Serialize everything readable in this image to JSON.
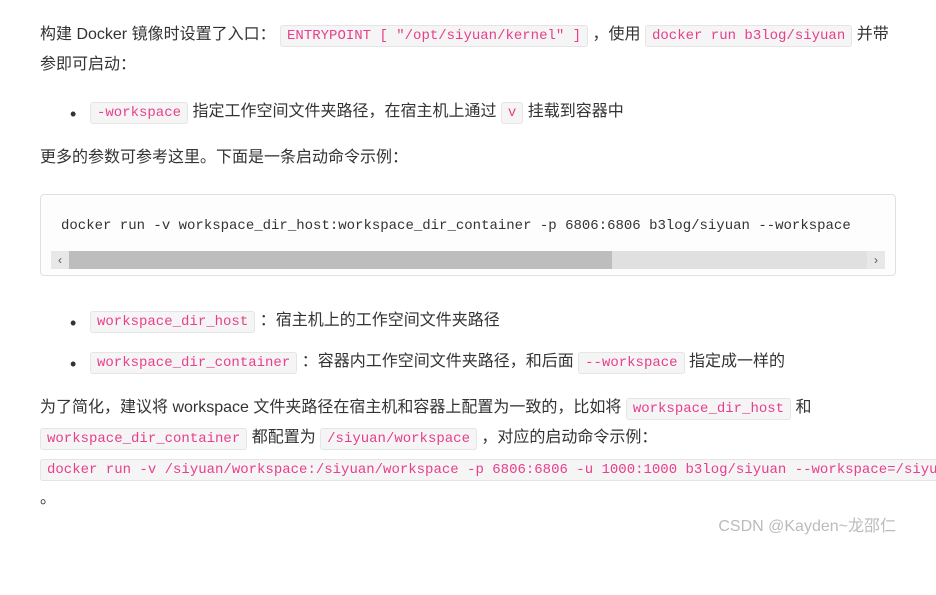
{
  "para1": {
    "t1": "构建 Docker 镜像时设置了入口：",
    "c1": "ENTRYPOINT [ \"/opt/siyuan/kernel\" ]",
    "t2": "，使用 ",
    "c2": "docker run b3log/siyuan",
    "t3": " 并带参即可启动："
  },
  "list1": {
    "item1": {
      "c1": "-workspace",
      "t1": " 指定工作空间文件夹路径，在宿主机上通过 ",
      "c2": "v",
      "t2": " 挂载到容器中"
    }
  },
  "para2": "更多的参数可参考这里。下面是一条启动命令示例：",
  "codeblock": "  docker run -v workspace_dir_host:workspace_dir_container -p 6806:6806 b3log/siyuan --workspace",
  "list2": {
    "item1": {
      "c1": "workspace_dir_host",
      "t1": "：宿主机上的工作空间文件夹路径"
    },
    "item2": {
      "c1": "workspace_dir_container",
      "t1": "：容器内工作空间文件夹路径，和后面 ",
      "c2": "--workspace",
      "t2": " 指定成一样的"
    }
  },
  "para3": {
    "t1": "为了简化，建议将 workspace 文件夹路径在宿主机和容器上配置为一致的，比如将 ",
    "c1": "workspace_dir_host",
    "t2": " 和 ",
    "c2": "workspace_dir_container",
    "t3": " 都配置为 ",
    "c3": "/siyuan/workspace",
    "t4": "，对应的启动命令示例：",
    "c4": "docker run -v /siyuan/workspace:/siyuan/workspace -p 6806:6806 -u 1000:1000 b3log/siyuan --workspace=/siyuan/workspace/",
    "t5": " 。"
  },
  "watermark": "CSDN @Kayden~龙邵仁",
  "scroll": {
    "left": "‹",
    "right": "›"
  }
}
